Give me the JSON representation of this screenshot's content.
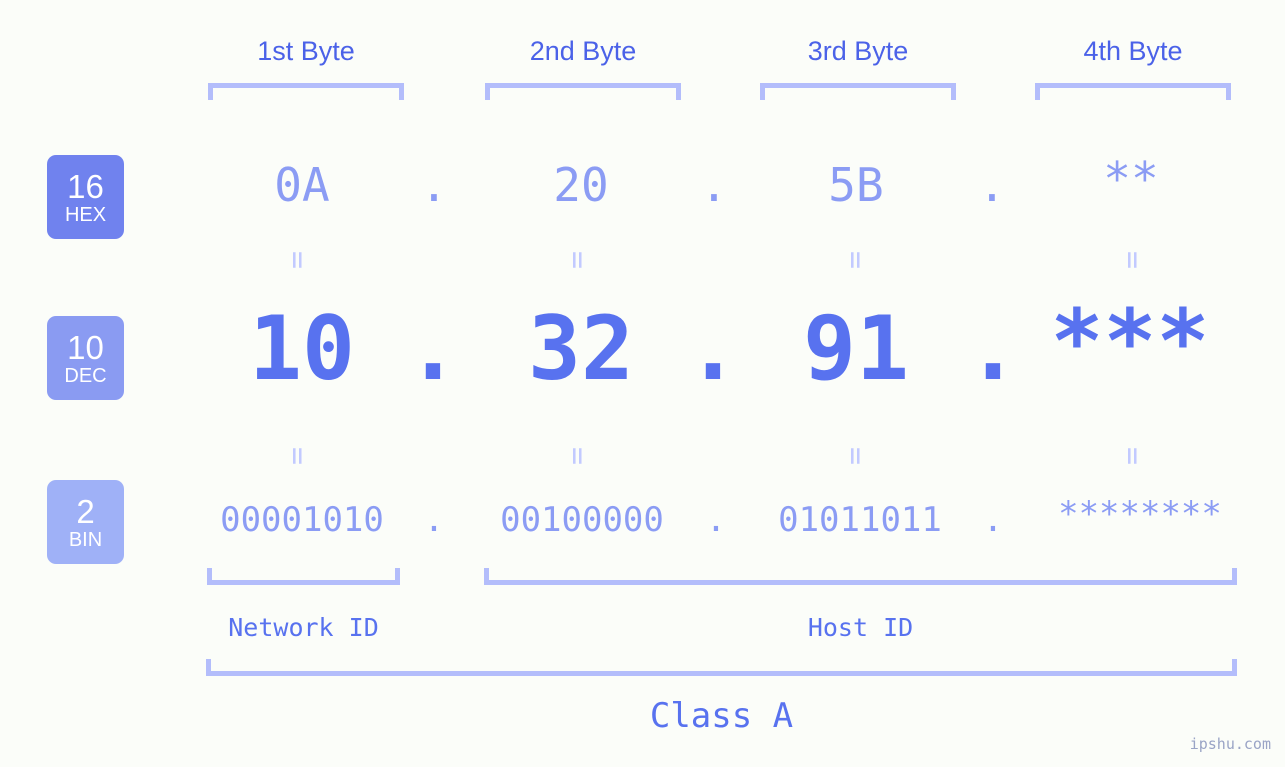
{
  "colors": {
    "background": "#fbfdf9",
    "accent_strong": "#5872ef",
    "accent_mid": "#8b9cf4",
    "accent_light": "#b3bdfb",
    "badge_hex": "#7082ee",
    "badge_dec": "#8a9bf2",
    "badge_bin": "#9fb1f7",
    "label_blue": "#4b62e8",
    "watermark": "#9aa4c6"
  },
  "header": {
    "byte_labels": [
      "1st Byte",
      "2nd Byte",
      "3rd Byte",
      "4th Byte"
    ]
  },
  "bases": [
    {
      "number": "16",
      "name": "HEX"
    },
    {
      "number": "10",
      "name": "DEC"
    },
    {
      "number": "2",
      "name": "BIN"
    }
  ],
  "rows": {
    "hex": {
      "base_number": "16",
      "base_name": "HEX",
      "values": [
        "0A",
        "20",
        "5B",
        "**"
      ],
      "separator": "."
    },
    "dec": {
      "base_number": "10",
      "base_name": "DEC",
      "values": [
        "10",
        "32",
        "91",
        "***"
      ],
      "separator": "."
    },
    "bin": {
      "base_number": "2",
      "base_name": "BIN",
      "values": [
        "00001010",
        "00100000",
        "01011011",
        "********"
      ],
      "separator": "."
    }
  },
  "equivalence_symbol": "=",
  "footer": {
    "network_id_label": "Network ID",
    "host_id_label": "Host ID",
    "class_label": "Class A"
  },
  "watermark": "ipshu.com"
}
